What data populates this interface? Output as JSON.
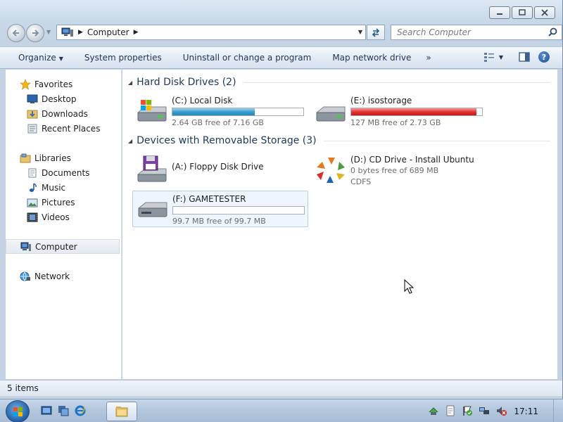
{
  "window": {
    "caption_buttons": [
      "minimize-icon",
      "maximize-icon",
      "close-icon"
    ]
  },
  "nav": {
    "breadcrumb": "Computer",
    "search_placeholder": "Search Computer"
  },
  "toolbar": {
    "organize": "Organize",
    "system_properties": "System properties",
    "uninstall": "Uninstall or change a program",
    "map_drive": "Map network drive",
    "more": "»"
  },
  "navpane": {
    "favorites": {
      "label": "Favorites",
      "items": [
        "Desktop",
        "Downloads",
        "Recent Places"
      ]
    },
    "libraries": {
      "label": "Libraries",
      "items": [
        "Documents",
        "Music",
        "Pictures",
        "Videos"
      ]
    },
    "computer": "Computer",
    "network": "Network"
  },
  "groups": {
    "hard_disks": "Hard Disk Drives (2)",
    "removable": "Devices with Removable Storage (3)"
  },
  "drives": {
    "c": {
      "name": "(C:) Local Disk",
      "free": "2.64 GB free of 7.16 GB",
      "used_fraction": 0.63,
      "color": "#2a8fc4"
    },
    "e": {
      "name": "(E:) isostorage",
      "free": "127 MB free of 2.73 GB",
      "used_fraction": 0.955,
      "color": "#d81e1e"
    },
    "a": {
      "name": "(A:) Floppy Disk Drive"
    },
    "d": {
      "name": "(D:) CD Drive - Install Ubuntu",
      "free": "0 bytes free of 689 MB",
      "fs": "CDFS"
    },
    "f": {
      "name": "(F:) GAMETESTER",
      "free": "99.7 MB free of 99.7 MB",
      "used_fraction": 0.0
    }
  },
  "statusbar": {
    "count": "5 items"
  },
  "taskbar": {
    "clock": "17:11"
  }
}
